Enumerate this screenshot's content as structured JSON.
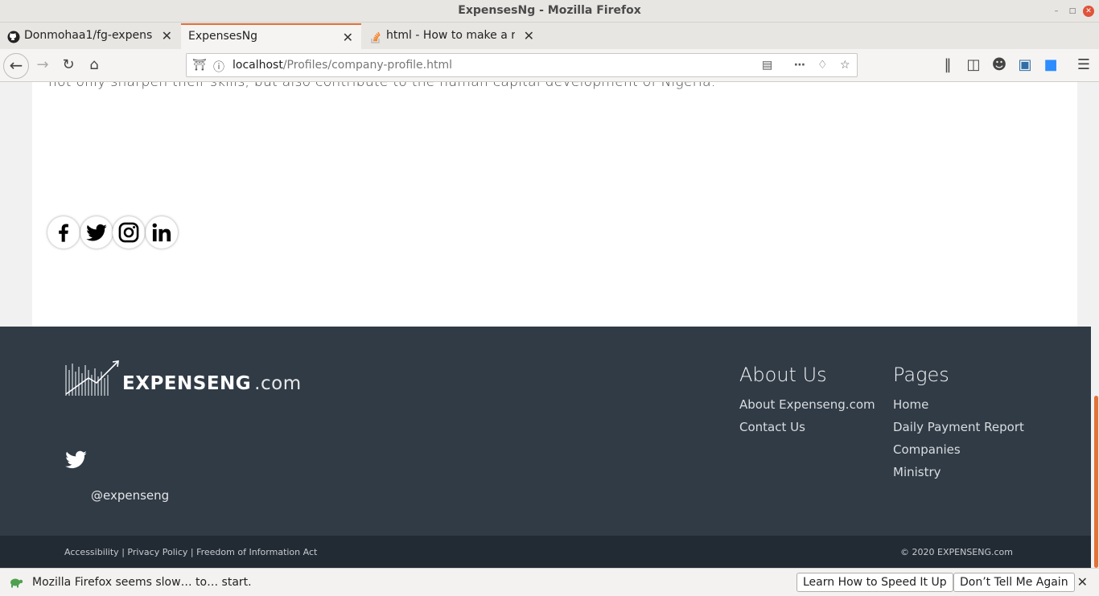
{
  "window": {
    "title": "ExpensesNg - Mozilla Firefox"
  },
  "tabs": [
    {
      "label": "Donmohaa1/fg-expense"
    },
    {
      "label": "ExpensesNg"
    },
    {
      "label": "html - How to make a rou"
    }
  ],
  "address": {
    "host": "localhost",
    "path": "/Profiles/company-profile.html"
  },
  "page": {
    "paragraph_tail": "not only sharpen their skills, but also contribute to the human capital development of Nigeria."
  },
  "footer": {
    "brand": "EXPENSENG",
    "brand_suffix": ".com",
    "twitter_handle": "@expenseng",
    "about": {
      "heading": "About Us",
      "links": [
        "About Expenseng.com",
        "Contact Us"
      ]
    },
    "pages": {
      "heading": "Pages",
      "links": [
        "Home",
        "Daily Payment Report",
        "Companies",
        "Ministry"
      ]
    },
    "subfooter": {
      "link1": "Accessibility",
      "link2": "Privacy Policy",
      "link3": "Freedom of Information Act",
      "separator": "|",
      "copyright": "© 2020 EXPENSENG.com"
    }
  },
  "notification": {
    "message": "Mozilla Firefox seems slow… to… start.",
    "learn_button": "Learn How to Speed It Up",
    "dismiss_button": "Don’t Tell Me Again"
  },
  "colors": {
    "tab_accent": "#e0733a",
    "footer_bg": "#303b46",
    "subfooter_bg": "#222a33"
  }
}
